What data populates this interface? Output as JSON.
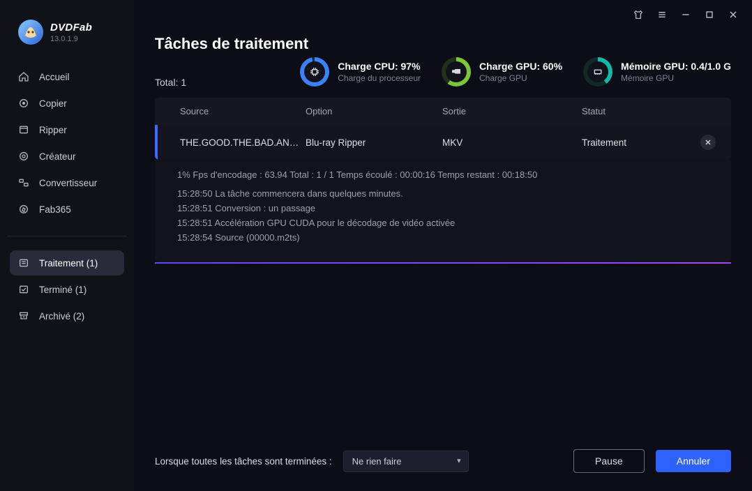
{
  "brand": "DVDFab",
  "version": "13.0.1.9",
  "sidebar": {
    "items": [
      {
        "label": "Accueil",
        "active": false,
        "icon": "home"
      },
      {
        "label": "Copier",
        "active": false,
        "icon": "copy"
      },
      {
        "label": "Ripper",
        "active": false,
        "icon": "rip"
      },
      {
        "label": "Créateur",
        "active": false,
        "icon": "disc"
      },
      {
        "label": "Convertisseur",
        "active": false,
        "icon": "convert"
      },
      {
        "label": "Fab365",
        "active": false,
        "icon": "compass"
      }
    ],
    "statusItems": [
      {
        "label": "Traitement (1)",
        "active": true,
        "icon": "list"
      },
      {
        "label": "Terminé (1)",
        "active": false,
        "icon": "check"
      },
      {
        "label": "Archivé (2)",
        "active": false,
        "icon": "archive"
      }
    ]
  },
  "header": {
    "title": "Tâches de traitement",
    "total_label": "Total:",
    "total_value": "1"
  },
  "metrics": {
    "cpu_title": "Charge CPU: 97%",
    "cpu_sub": "Charge du processeur",
    "gpu_title": "Charge GPU: 60%",
    "gpu_sub": "Charge GPU",
    "mem_title": "Mémoire GPU: 0.4/1.0 G",
    "mem_sub": "Mémoire GPU"
  },
  "table": {
    "headers": {
      "source": "Source",
      "option": "Option",
      "sortie": "Sortie",
      "statut": "Statut"
    },
    "row": {
      "source": "THE.GOOD.THE.BAD.AN…",
      "option": "Blu-ray Ripper",
      "sortie": "MKV",
      "statut": "Traitement"
    }
  },
  "progress": {
    "stats": "1%  Fps d'encodage : 63.94   Total : 1 / 1   Temps écoulé : 00:00:16  Temps restant : 00:18:50",
    "lines": [
      "15:28:50  La tâche commencera dans quelques minutes.",
      "15:28:51  Conversion : un passage",
      "15:28:51  Accélération GPU CUDA pour le décodage de vidéo activée",
      "15:28:54  Source (00000.m2ts)"
    ]
  },
  "footer": {
    "label": "Lorsque toutes les tâches sont terminées :",
    "select_value": "Ne rien faire",
    "pause": "Pause",
    "cancel": "Annuler"
  }
}
